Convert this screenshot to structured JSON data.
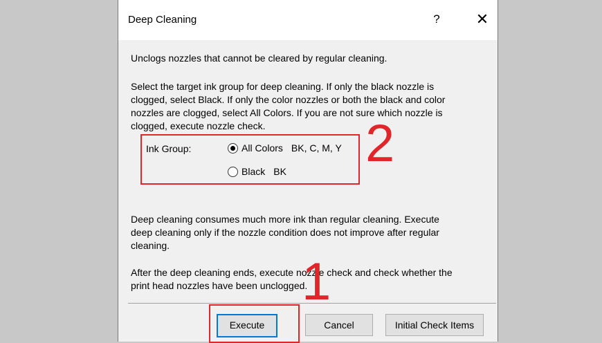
{
  "dialog": {
    "title": "Deep Cleaning",
    "help_label": "?",
    "close_label": "✕"
  },
  "content": {
    "intro": "Unclogs nozzles that cannot be cleared by regular cleaning.",
    "select_text_lines": [
      "Select the target ink group for deep cleaning. If only the black nozzle is",
      "clogged, select Black. If only the color nozzles or both the black and color",
      "nozzles are clogged, select All Colors. If you are not sure which nozzle is",
      "clogged, execute nozzle check."
    ],
    "ink_group_label": "Ink Group:",
    "options": [
      {
        "name": "All Colors",
        "detail": "BK, C, M, Y",
        "checked": true
      },
      {
        "name": "Black",
        "detail": "BK",
        "checked": false
      }
    ],
    "warning_lines": [
      "Deep cleaning consumes much more ink than regular cleaning. Execute",
      "deep cleaning only if the nozzle condition does not improve after regular",
      "cleaning."
    ],
    "after_lines": [
      "After the deep cleaning ends, execute nozzle check and check whether the",
      "print head nozzles have been unclogged."
    ]
  },
  "buttons": {
    "execute": "Execute",
    "cancel": "Cancel",
    "initial_check": "Initial Check Items"
  },
  "annotations": {
    "step1": "1",
    "step2": "2"
  },
  "colors": {
    "highlight": "#e0262b",
    "default_button_border": "#0078d7"
  }
}
